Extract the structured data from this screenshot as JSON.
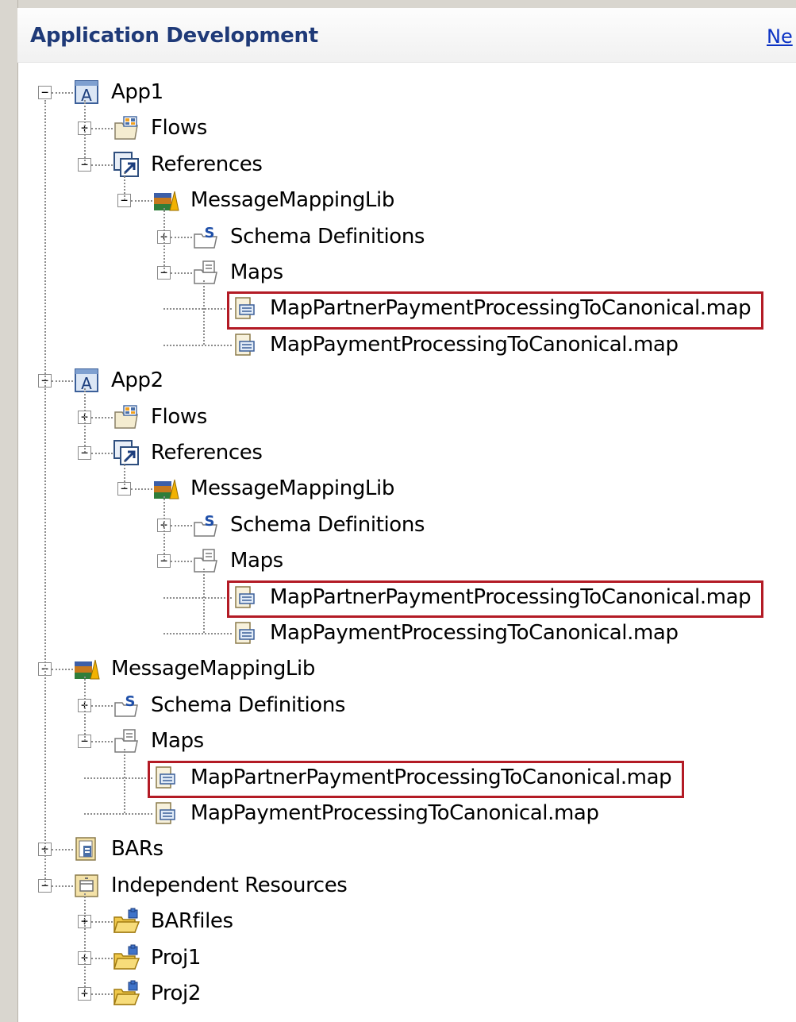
{
  "header": {
    "title": "Application Development",
    "link": "Ne"
  },
  "colors": {
    "highlight": "#b31b25",
    "title": "#1f3a78",
    "link": "#0b32c4"
  },
  "tree": {
    "app1": {
      "label": "App1",
      "icon": "application-icon",
      "expanded": true,
      "flows": {
        "label": "Flows",
        "icon": "flows-folder-icon",
        "expanded": false
      },
      "references": {
        "label": "References",
        "icon": "references-icon",
        "expanded": true,
        "library": {
          "label": "MessageMappingLib",
          "icon": "library-icon",
          "expanded": true,
          "schema": {
            "label": "Schema Definitions",
            "icon": "schema-folder-icon",
            "expanded": false
          },
          "maps": {
            "label": "Maps",
            "icon": "maps-folder-icon",
            "expanded": true,
            "items": [
              {
                "label": "MapPartnerPaymentProcessingToCanonical.map",
                "icon": "map-file-icon",
                "highlighted": true
              },
              {
                "label": "MapPaymentProcessingToCanonical.map",
                "icon": "map-file-icon",
                "highlighted": false
              }
            ]
          }
        }
      }
    },
    "app2": {
      "label": "App2",
      "icon": "application-icon",
      "expanded": true,
      "flows": {
        "label": "Flows",
        "icon": "flows-folder-icon",
        "expanded": false
      },
      "references": {
        "label": "References",
        "icon": "references-icon",
        "expanded": true,
        "library": {
          "label": "MessageMappingLib",
          "icon": "library-icon",
          "expanded": true,
          "schema": {
            "label": "Schema Definitions",
            "icon": "schema-folder-icon",
            "expanded": false
          },
          "maps": {
            "label": "Maps",
            "icon": "maps-folder-icon",
            "expanded": true,
            "items": [
              {
                "label": "MapPartnerPaymentProcessingToCanonical.map",
                "icon": "map-file-icon",
                "highlighted": true
              },
              {
                "label": "MapPaymentProcessingToCanonical.map",
                "icon": "map-file-icon",
                "highlighted": false
              }
            ]
          }
        }
      }
    },
    "library": {
      "label": "MessageMappingLib",
      "icon": "library-icon",
      "expanded": true,
      "schema": {
        "label": "Schema Definitions",
        "icon": "schema-folder-icon",
        "expanded": false
      },
      "maps": {
        "label": "Maps",
        "icon": "maps-folder-icon",
        "expanded": true,
        "items": [
          {
            "label": "MapPartnerPaymentProcessingToCanonical.map",
            "icon": "map-file-icon",
            "highlighted": true
          },
          {
            "label": "MapPaymentProcessingToCanonical.map",
            "icon": "map-file-icon",
            "highlighted": false
          }
        ]
      }
    },
    "bars": {
      "label": "BARs",
      "icon": "bars-container-icon",
      "expanded": false
    },
    "independent": {
      "label": "Independent Resources",
      "icon": "independent-resources-icon",
      "expanded": true,
      "items": [
        {
          "label": "BARfiles",
          "icon": "project-folder-icon",
          "expanded": false
        },
        {
          "label": "Proj1",
          "icon": "project-folder-icon",
          "expanded": false
        },
        {
          "label": "Proj2",
          "icon": "project-folder-icon",
          "expanded": false
        }
      ]
    }
  }
}
